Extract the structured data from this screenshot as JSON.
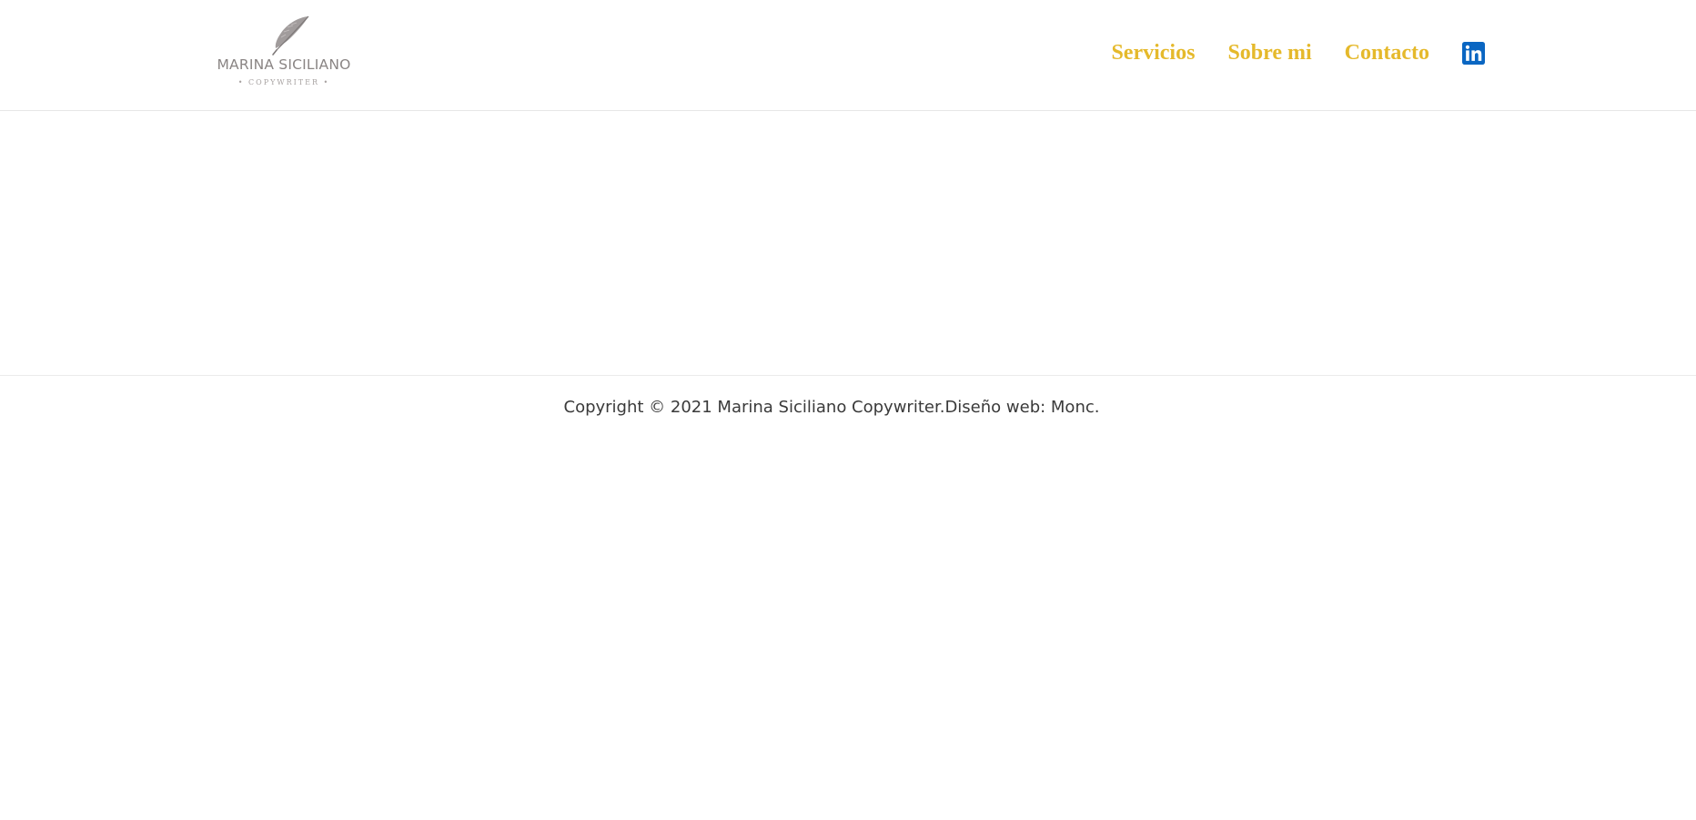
{
  "header": {
    "logo": {
      "icon": "feather-icon",
      "name": "MARINA SICILIANO",
      "subtitle": "• COPYWRITER •"
    },
    "nav": {
      "items": [
        {
          "label": "Servicios"
        },
        {
          "label": "Sobre mi"
        },
        {
          "label": "Contacto"
        }
      ],
      "social_icon": "linkedin-icon"
    }
  },
  "footer": {
    "copyright_text": "Copyright © 2021 Marina Siciliano Copywriter.",
    "credit_text": "Diseño web: ",
    "credit_link": "Monc."
  },
  "colors": {
    "accent": "#e5b92b",
    "linkedin": "#0a66c2",
    "text": "#3a3a3a",
    "logo_text": "#8a8584"
  }
}
